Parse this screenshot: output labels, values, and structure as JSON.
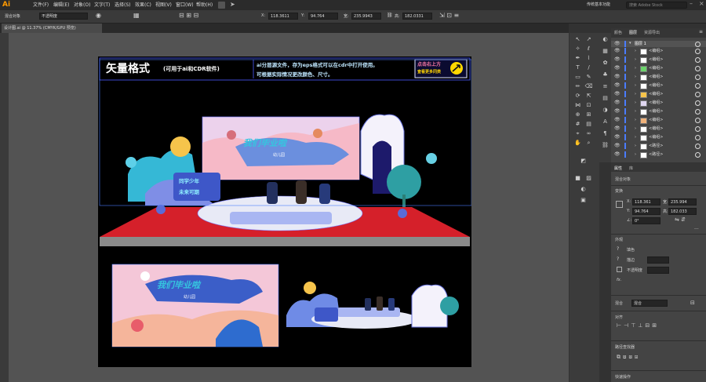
{
  "app": {
    "logo": "Ai"
  },
  "menu": [
    "文件(F)",
    "编辑(E)",
    "对象(O)",
    "文字(T)",
    "选择(S)",
    "效果(C)",
    "视图(V)",
    "窗口(W)",
    "帮助(H)"
  ],
  "workspace": "传统基本功能",
  "search_placeholder": "搜索 Adobe Stock",
  "control": {
    "selection_label": "混合对象",
    "opacity_label": "不透明度",
    "x": "118.3611",
    "y": "94.764",
    "w": "235.9943",
    "h": "182.0331"
  },
  "document_tab": "设计图.ai @ 11.37% (CMYK/GPU 预览)",
  "design": {
    "headline": "矢量格式",
    "headline_sub": "(可用于ai和CDR软件)",
    "info_line1": "ai分层源文件，存为eps格式可以在cdr中打开使用。",
    "info_line2": "可根据实际情况更改颜色、尺寸。",
    "corner_line1": "点击右上方",
    "corner_line2": "查看更多同类",
    "banner_title": "我们毕业啦",
    "banner_sub": "幼儿园",
    "sign_line1": "同学少年",
    "sign_line2": "未来可期",
    "small_banner_title": "我们毕业啦",
    "small_banner_sub": "幼儿园"
  },
  "panel": {
    "tabs": [
      "颜色",
      "图层",
      "资源导出"
    ],
    "layer_name": "图层 1",
    "layers": [
      "<编组>",
      "<编组>",
      "<编组>",
      "<编组>",
      "<编组>",
      "<编组>",
      "<编组>",
      "<编组>",
      "<编组>",
      "<编组>",
      "<编组>",
      "<路径>",
      "<路径>"
    ],
    "props_tabs": [
      "属性",
      "库"
    ],
    "blend_object": "混合对象",
    "transform_label": "变换",
    "x": "118.361",
    "y": "94.764",
    "w": "235.994",
    "h": "182.033",
    "angle": "0°",
    "appearance_label": "外观",
    "fill_label": "填色",
    "stroke_label": "描边",
    "opacity_label": "不透明度",
    "fx_label": "fx.",
    "blend_label": "混合",
    "blend_value": "混合",
    "align_label": "对齐",
    "pathfinder_label": "路径查找器",
    "quick_label": "快速操作"
  }
}
